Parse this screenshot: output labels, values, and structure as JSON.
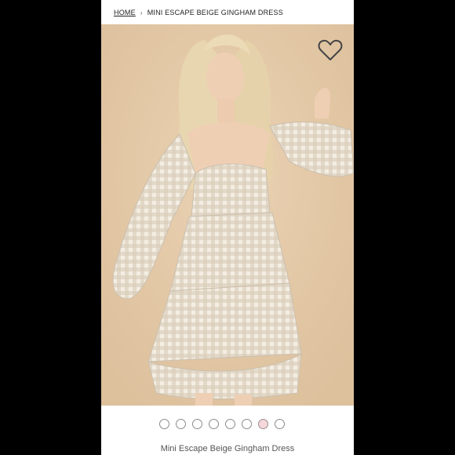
{
  "breadcrumb": {
    "home": "HOME",
    "separator": "›",
    "current": "MINI ESCAPE BEIGE GINGHAM DRESS"
  },
  "image": {
    "description_icon": "product-photo",
    "background": "#e3c9a8"
  },
  "wishlist": {
    "icon": "heart-outline-icon"
  },
  "carousel": {
    "count": 8,
    "active_index": 6,
    "active_color": "#f4d6db"
  },
  "product": {
    "title": "Mini Escape Beige Gingham Dress"
  }
}
